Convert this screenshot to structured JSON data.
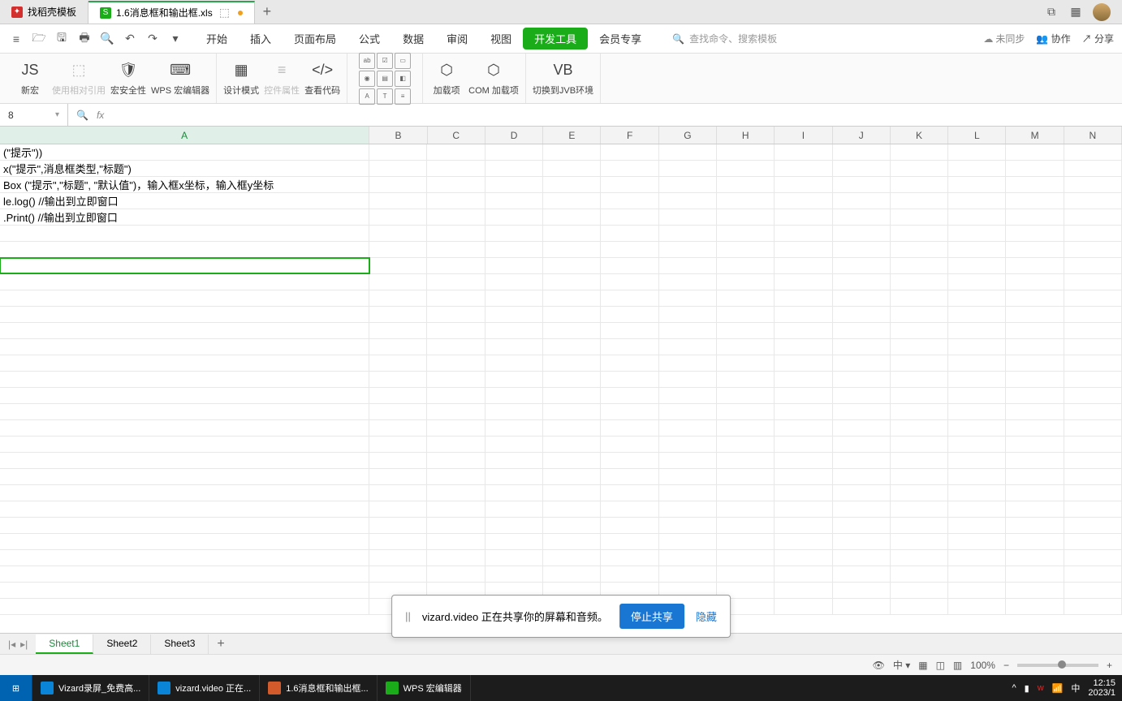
{
  "tabs": {
    "items": [
      {
        "label": "找稻壳模板",
        "iconColor": "red"
      },
      {
        "label": "1.6消息框和输出框.xls",
        "iconColor": "green",
        "active": true,
        "hasDot": true
      }
    ]
  },
  "ribbonMenu": {
    "items": [
      "开始",
      "插入",
      "页面布局",
      "公式",
      "数据",
      "审阅",
      "视图",
      "开发工具",
      "会员专享"
    ],
    "activeIndex": 7,
    "searchPlaceholder": "查找命令、搜索模板",
    "syncLabel": "未同步",
    "collabLabel": "协作",
    "shareLabel": "分享"
  },
  "toolbar": {
    "group1": [
      {
        "label": "新宏",
        "icon": "JS"
      },
      {
        "label": "使用相对引用",
        "icon": "⬚",
        "disabled": true
      },
      {
        "label": "宏安全性",
        "icon": "⚙"
      },
      {
        "label": "WPS 宏编辑器",
        "icon": "⌨"
      }
    ],
    "group2": [
      {
        "label": "设计模式",
        "icon": "▦"
      },
      {
        "label": "控件属性",
        "icon": "≡",
        "disabled": true
      },
      {
        "label": "查看代码",
        "icon": "</>"
      }
    ],
    "group3": [
      {
        "label": "加载项",
        "icon": "⬡"
      },
      {
        "label": "COM 加载项",
        "icon": "⬡"
      }
    ],
    "group4": [
      {
        "label": "切换到JVB环境",
        "icon": "VB"
      }
    ]
  },
  "formulaBar": {
    "nameBox": "8",
    "fxValue": ""
  },
  "columns": [
    "A",
    "B",
    "C",
    "D",
    "E",
    "F",
    "G",
    "H",
    "I",
    "J",
    "K",
    "L",
    "M",
    "N"
  ],
  "cells": {
    "r1": "(\"提示\"))",
    "r2": "x(\"提示\",消息框类型,\"标题\")",
    "r3": "Box (\"提示\",\"标题\", \"默认值\")，输入框x坐标，输入框y坐标",
    "r4": "le.log()   //输出到立即窗口",
    "r5": ".Print()   //输出到立即窗口"
  },
  "selectedRow": 8,
  "sheets": {
    "items": [
      "Sheet1",
      "Sheet2",
      "Sheet3"
    ],
    "activeIndex": 0
  },
  "statusBar": {
    "zoom": "100%"
  },
  "shareOverlay": {
    "message": "vizard.video 正在共享你的屏幕和音频。",
    "stopLabel": "停止共享",
    "hideLabel": "隐藏"
  },
  "taskbar": {
    "items": [
      {
        "label": "Vizard录屏_免费高...",
        "color": "#0a84d6"
      },
      {
        "label": "vizard.video 正在...",
        "color": "#0a84d6"
      },
      {
        "label": "1.6消息框和输出框...",
        "color": "#d35a2a"
      },
      {
        "label": "WPS 宏编辑器",
        "color": "#1aad19"
      }
    ],
    "ime": "中",
    "time": "12:15",
    "date": "2023/1"
  }
}
